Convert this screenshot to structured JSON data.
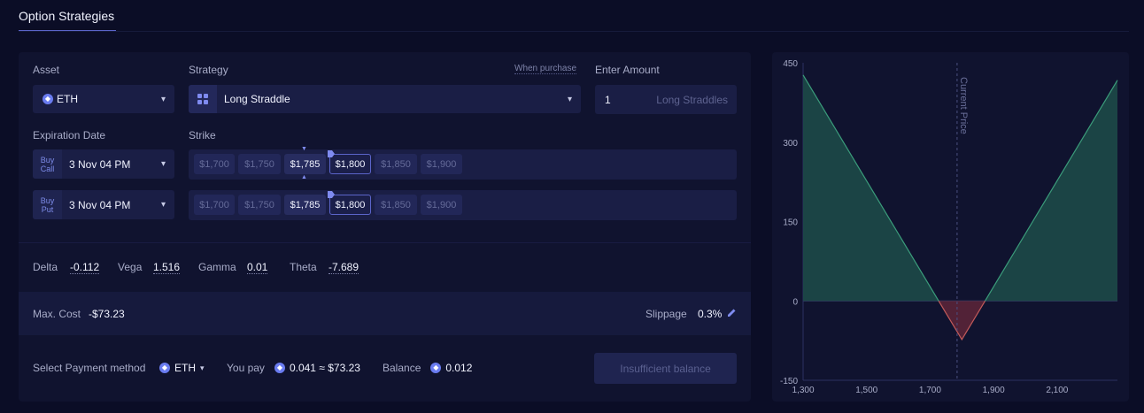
{
  "page": {
    "title": "Option Strategies"
  },
  "asset": {
    "label": "Asset",
    "value": "ETH"
  },
  "strategy": {
    "label": "Strategy",
    "value": "Long Straddle",
    "when_purchase": "When purchase"
  },
  "amount": {
    "label": "Enter Amount",
    "value": "1",
    "unit": "Long Straddles"
  },
  "expiration": {
    "label": "Expiration Date",
    "call": {
      "tag_line1": "Buy",
      "tag_line2": "Call",
      "value": "3 Nov 04 PM"
    },
    "put": {
      "tag_line1": "Buy",
      "tag_line2": "Put",
      "value": "3 Nov 04 PM"
    }
  },
  "strike": {
    "label": "Strike",
    "options": [
      "$1,700",
      "$1,750",
      "$1,785",
      "$1,800",
      "$1,850",
      "$1,900"
    ],
    "current_price_strike": "$1,785",
    "call_selected": "$1,800",
    "put_selected": "$1,800"
  },
  "greeks": {
    "delta_label": "Delta",
    "delta": "-0.112",
    "vega_label": "Vega",
    "vega": "1.516",
    "gamma_label": "Gamma",
    "gamma": "0.01",
    "theta_label": "Theta",
    "theta": "-7.689"
  },
  "cost": {
    "label": "Max. Cost",
    "value": "-$73.23",
    "slippage_label": "Slippage",
    "slippage": "0.3%"
  },
  "payment": {
    "label": "Select Payment method",
    "method": "ETH",
    "you_pay_label": "You pay",
    "you_pay": "0.041 ≈ $73.23",
    "balance_label": "Balance",
    "balance": "0.012",
    "button": "Insufficient balance"
  },
  "colors": {
    "accent": "#5b64c9",
    "profit": "#1d4a48",
    "loss": "#5a2538",
    "profit_line": "#3b9c7b",
    "loss_line": "#c25a5a"
  },
  "chart_data": {
    "type": "area",
    "x": [
      1300,
      1800,
      2300
    ],
    "y": [
      427,
      -73,
      427
    ],
    "xticks": [
      "1,300",
      "1,500",
      "1,700",
      "1,900",
      "2,100"
    ],
    "yticks": [
      "450",
      "300",
      "150",
      "0",
      "-150"
    ],
    "xlim": [
      1300,
      2290
    ],
    "ylim": [
      -150,
      450
    ],
    "annotation": "Current Price",
    "current_price": 1785
  }
}
